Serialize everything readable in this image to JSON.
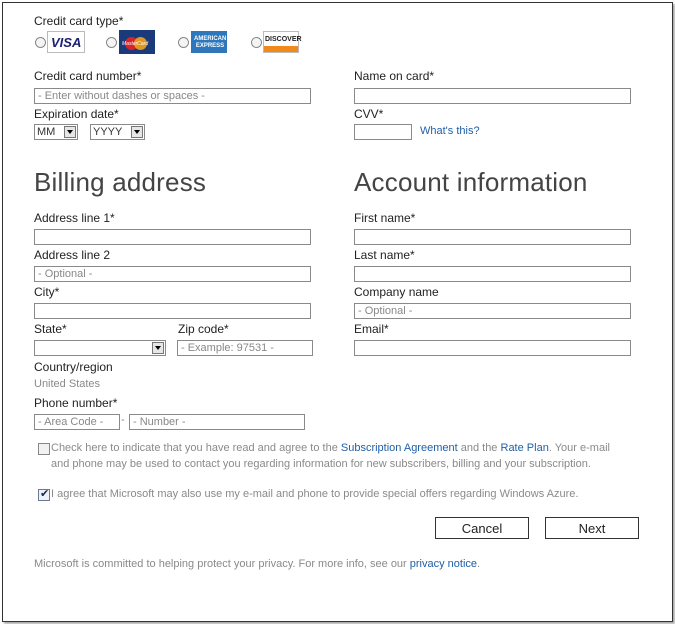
{
  "payment": {
    "card_type_label": "Credit card type*",
    "cards": [
      {
        "brand_text": "VISA"
      },
      {
        "brand_text": "MasterCard"
      },
      {
        "brand_text": "AMERICAN EXPRESS"
      },
      {
        "brand_text": "DISCOVER"
      }
    ],
    "card_number_label": "Credit card number*",
    "card_number_placeholder": "- Enter without dashes or spaces -",
    "name_on_card_label": "Name on card*",
    "expiration_label": "Expiration date*",
    "month_value": "MM",
    "year_value": "YYYY",
    "cvv_label": "CVV*",
    "whats_this": "What's this?"
  },
  "billing": {
    "heading": "Billing address",
    "address1_label": "Address line 1*",
    "address2_label": "Address line 2",
    "address2_placeholder": "- Optional -",
    "city_label": "City*",
    "state_label": "State*",
    "zip_label": "Zip code*",
    "zip_placeholder": "- Example: 97531 -",
    "country_label": "Country/region",
    "country_value": "United States",
    "phone_label": "Phone number*",
    "area_code_placeholder": "- Area Code -",
    "dash": "-",
    "number_placeholder": "- Number -"
  },
  "account": {
    "heading": "Account information",
    "first_name_label": "First name*",
    "last_name_label": "Last name*",
    "company_label": "Company name",
    "company_placeholder": "- Optional -",
    "email_label": "Email*"
  },
  "agreement": {
    "text_before": "Check here to indicate that you have read and agree to the ",
    "subscription_link": "Subscription Agreement",
    "text_and": " and the ",
    "rate_plan_link": "Rate Plan",
    "text_after": ". Your e-mail and phone may be used to contact you regarding information for new subscribers, billing and your subscription.",
    "offers_text": "I agree that Microsoft may also use my e-mail and phone to provide special offers regarding Windows Azure."
  },
  "buttons": {
    "cancel": "Cancel",
    "next": "Next"
  },
  "privacy": {
    "text": "Microsoft is committed to helping protect your privacy. For more info, see our ",
    "link": "privacy notice",
    "period": "."
  }
}
